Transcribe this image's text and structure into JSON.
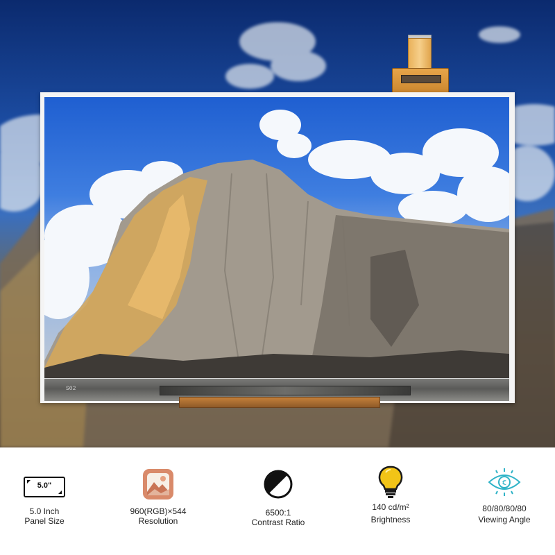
{
  "panel": {
    "bezel_code": "S02"
  },
  "specs": [
    {
      "icon": "panel-size-icon",
      "badge": "5.0\"",
      "value": "5.0 Inch",
      "label": "Panel Size"
    },
    {
      "icon": "resolution-image-icon",
      "value": "960(RGB)×544",
      "label": "Resolution"
    },
    {
      "icon": "contrast-icon",
      "value": "6500:1",
      "label": "Contrast Ratio"
    },
    {
      "icon": "lightbulb-icon",
      "value": "140 cd/m²",
      "label": "Brightness"
    },
    {
      "icon": "viewing-angle-eye-icon",
      "value": "80/80/80/80",
      "label": "Viewing Angle"
    }
  ],
  "colors": {
    "bulb": "#f2c417",
    "eye": "#2fb3c7",
    "image_icon": "#d98a6a"
  }
}
